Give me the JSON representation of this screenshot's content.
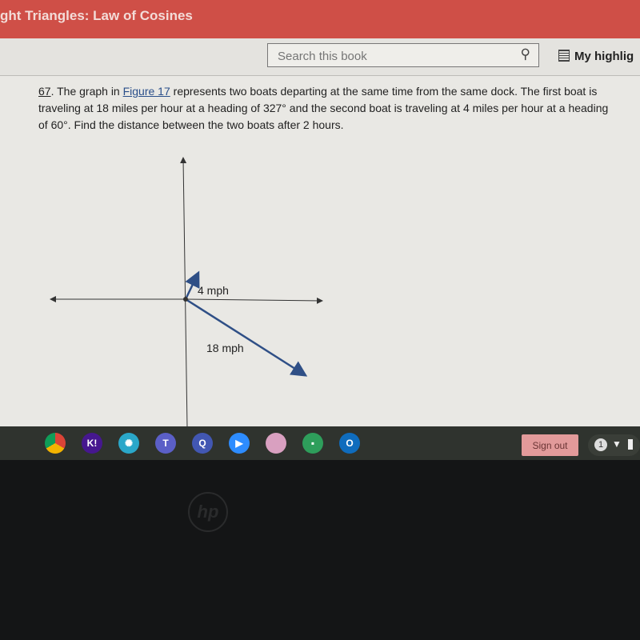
{
  "header": {
    "title": "ght Triangles: Law of Cosines"
  },
  "toolbar": {
    "search_placeholder": "Search this book",
    "search_icon": "search-icon",
    "highlights_label": "My highlig"
  },
  "problem": {
    "number": "67",
    "text_before": ". The graph in ",
    "link": "Figure 17",
    "text_after": " represents two boats departing at the same time from the same dock. The first boat is traveling at 18 miles per hour at a heading of 327° and the second boat is traveling at 4 miles per hour at a heading of 60°. Find the distance between the two boats after 2 hours."
  },
  "figure": {
    "label_small": "4 mph",
    "label_large": "18 mph",
    "vector_color": "#2f4f86"
  },
  "shelf": {
    "apps": [
      {
        "name": "chrome",
        "glyph": "",
        "color": "#4a8f3c"
      },
      {
        "name": "kahoot",
        "glyph": "K!",
        "color": "#46178f"
      },
      {
        "name": "app-burst",
        "glyph": "✺",
        "color": "#2aa7c9"
      },
      {
        "name": "teams",
        "glyph": "T",
        "color": "#5b5fc7"
      },
      {
        "name": "quizlet",
        "glyph": "Q",
        "color": "#4257b2"
      },
      {
        "name": "zoom",
        "glyph": "▶",
        "color": "#2d8cff"
      },
      {
        "name": "app-photo",
        "glyph": "",
        "color": "#d9a0c0"
      },
      {
        "name": "classroom",
        "glyph": "▪",
        "color": "#2e9e5b"
      },
      {
        "name": "outlook",
        "glyph": "O",
        "color": "#0f6cbd"
      }
    ],
    "sign_out": "Sign out",
    "notification_count": "1"
  },
  "bezel": {
    "logo": "hp"
  }
}
